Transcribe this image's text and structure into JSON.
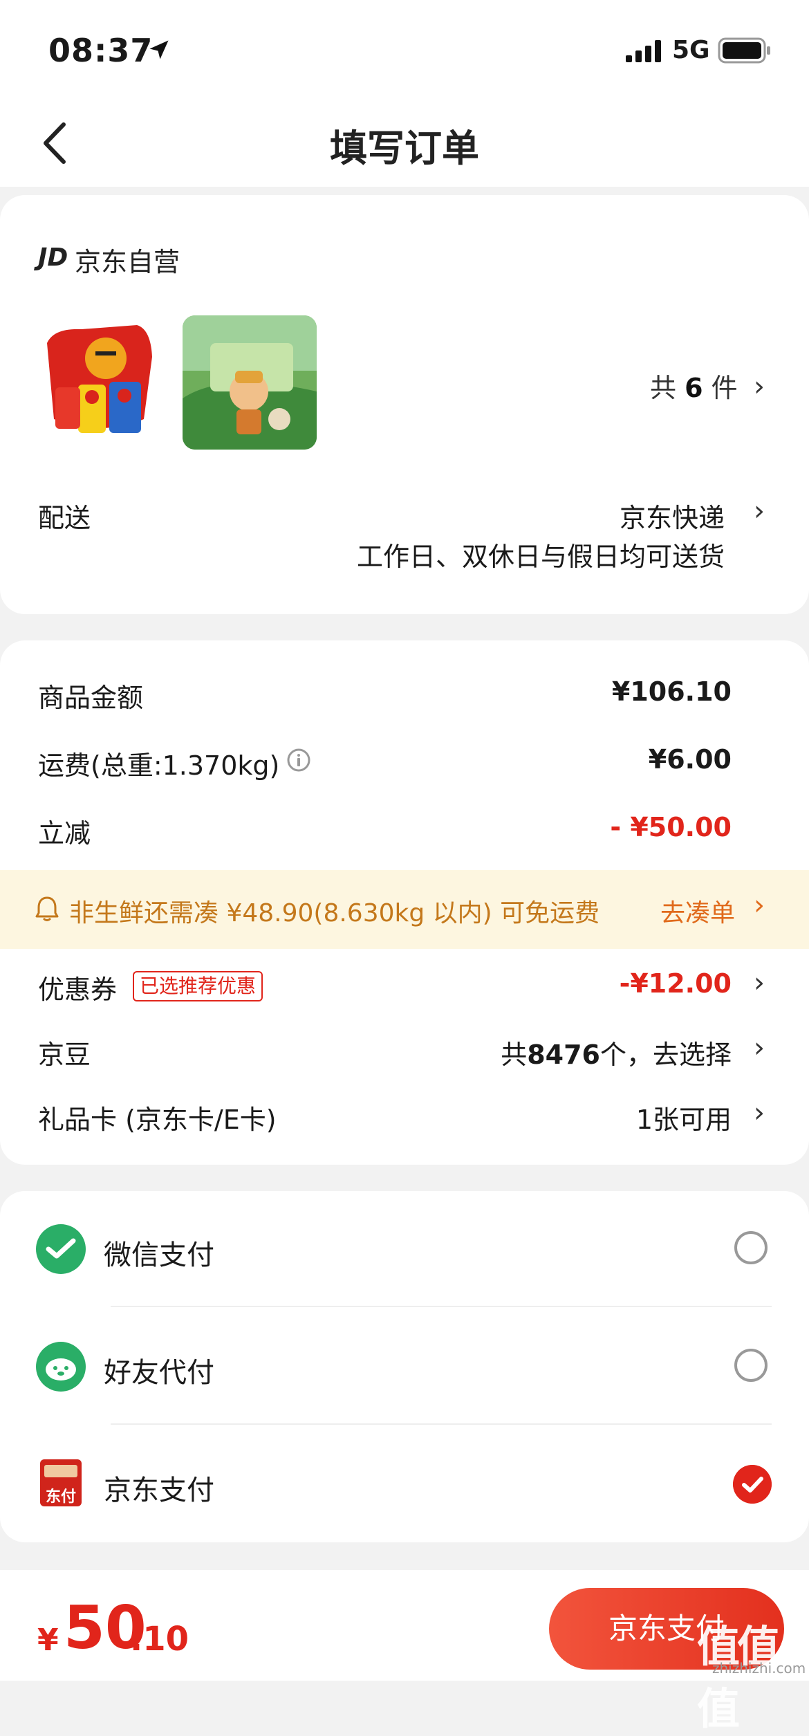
{
  "status_bar": {
    "time": "08:37",
    "network": "5G"
  },
  "header": {
    "title": "填写订单"
  },
  "shop": {
    "logo": "JD",
    "name": "京东自营"
  },
  "items": {
    "count_prefix": "共",
    "count": "6",
    "count_suffix": "件"
  },
  "delivery": {
    "label": "配送",
    "method": "京东快递",
    "note": "工作日、双休日与假日均可送货"
  },
  "summary": {
    "goods_label": "商品金额",
    "goods_value": "¥106.10",
    "shipping_label": "运费(总重:1.370kg)",
    "shipping_value": "¥6.00",
    "discount_label": "立减",
    "discount_value": "- ¥50.00"
  },
  "banner": {
    "text": "非生鲜还需凑 ¥48.90(8.630kg 以内) 可免运费",
    "action": "去凑单"
  },
  "coupon": {
    "label": "优惠券",
    "tag": "已选推荐优惠",
    "value": "-¥12.00"
  },
  "jingdou": {
    "label": "京豆",
    "value_prefix": "共",
    "count": "8476",
    "value_suffix": "个，去选择"
  },
  "giftcard": {
    "label": "礼品卡 (京东卡/E卡)",
    "value": "1张可用"
  },
  "payment": {
    "options": [
      {
        "label": "微信支付",
        "selected": false,
        "icon": "wechat-icon"
      },
      {
        "label": "好友代付",
        "selected": false,
        "icon": "friend-pay-icon"
      },
      {
        "label": "京东支付",
        "selected": true,
        "icon": "jd-pay-icon",
        "icon_text": "东付"
      }
    ]
  },
  "footer": {
    "currency": "¥",
    "total_int": "50",
    "total_dec": ".10",
    "pay_button": "京东支付"
  },
  "watermark": {
    "text": "值值值",
    "sub": "zhizhizhi.com"
  },
  "colors": {
    "accent": "#e1251b",
    "wechat": "#2aae67",
    "banner_bg": "#fdf6e0"
  }
}
